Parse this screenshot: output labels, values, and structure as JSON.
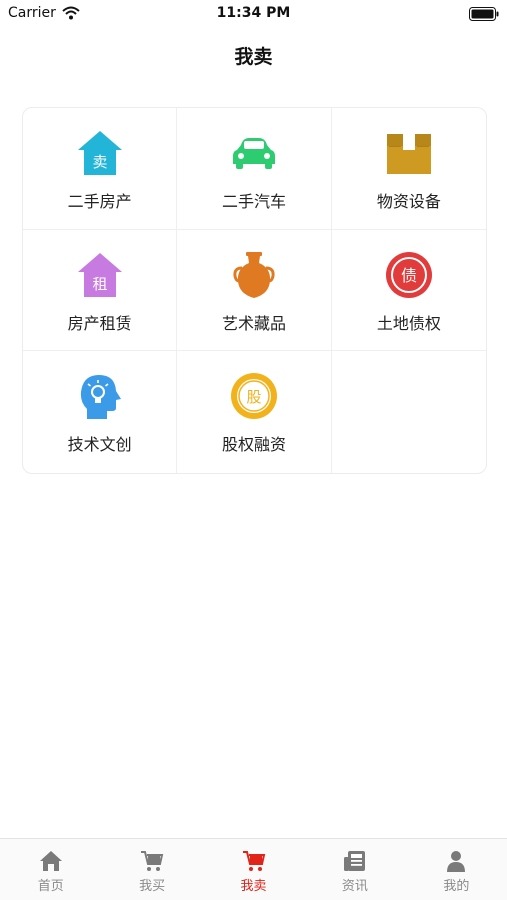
{
  "status_bar": {
    "carrier": "Carrier",
    "time": "11:34 PM"
  },
  "header": {
    "title": "我卖"
  },
  "categories": [
    {
      "label": "二手房产",
      "icon": "house-sell-icon",
      "icon_text": "卖",
      "color": "#22b5d8"
    },
    {
      "label": "二手汽车",
      "icon": "car-icon",
      "color": "#2ecc71"
    },
    {
      "label": "物资设备",
      "icon": "box-icon",
      "color": "#cf9a22"
    },
    {
      "label": "房产租赁",
      "icon": "house-rent-icon",
      "icon_text": "租",
      "color": "#c77be0"
    },
    {
      "label": "艺术藏品",
      "icon": "vase-icon",
      "color": "#e07a22"
    },
    {
      "label": "土地债权",
      "icon": "debt-badge-icon",
      "icon_text": "债",
      "color": "#e23b3b"
    },
    {
      "label": "技术文创",
      "icon": "idea-head-icon",
      "color": "#3b9be8"
    },
    {
      "label": "股权融资",
      "icon": "equity-coin-icon",
      "icon_text": "股",
      "color": "#f2b21c"
    }
  ],
  "tabbar": {
    "items": [
      {
        "label": "首页",
        "icon": "home-icon"
      },
      {
        "label": "我买",
        "icon": "cart-icon"
      },
      {
        "label": "我卖",
        "icon": "cart-sell-icon",
        "active": true
      },
      {
        "label": "资讯",
        "icon": "news-icon"
      },
      {
        "label": "我的",
        "icon": "person-icon"
      }
    ],
    "active_color": "#e2231a",
    "inactive_color": "#8a8a8a"
  }
}
